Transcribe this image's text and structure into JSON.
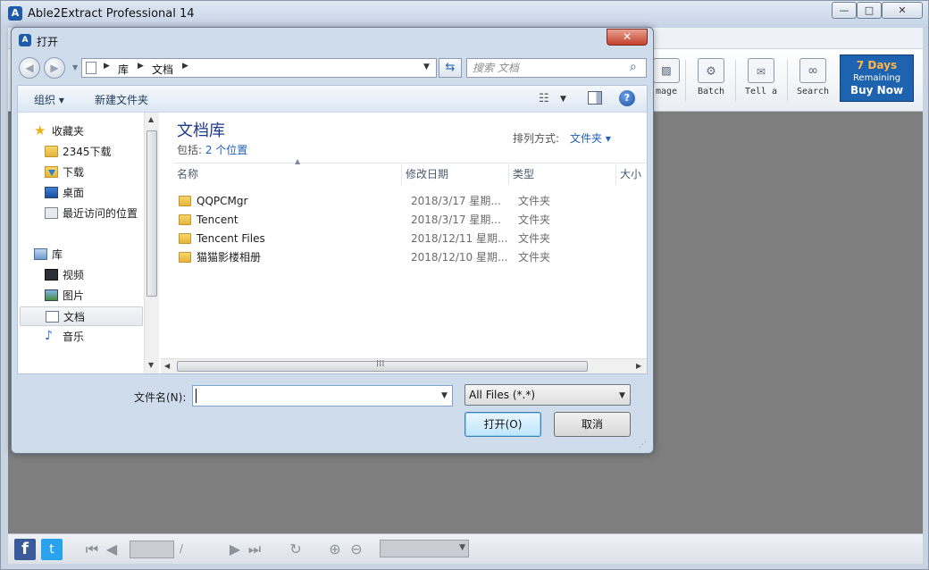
{
  "app": {
    "title": "Able2Extract Professional 14",
    "icon": "app-logo-icon",
    "window_buttons": {
      "minimize": "—",
      "maximize": "□",
      "close": "✕"
    },
    "toolbar": {
      "tools": [
        {
          "label": "mage",
          "icon": "image-icon"
        },
        {
          "label": "Batch",
          "icon": "batch-gear-icon"
        },
        {
          "label": "Tell a",
          "icon": "envelope-icon"
        },
        {
          "label": "Search",
          "icon": "binoculars-icon"
        }
      ],
      "promo": {
        "days": "7 Days",
        "remaining": "Remaining",
        "buy": "Buy Now",
        "bg_color": "#1e63b0",
        "days_color": "#ffb64a"
      }
    },
    "statusbar": {
      "facebook": "f",
      "twitter": "t",
      "page_separator": "/"
    }
  },
  "dialog": {
    "title": "打开",
    "close_glyph": "✕",
    "address": {
      "crumbs": [
        "库",
        "文档"
      ],
      "search_placeholder": "搜索 文档"
    },
    "commands": {
      "organize": "组织 ▾",
      "new_folder": "新建文件夹"
    },
    "nav": {
      "favorites": {
        "label": "收藏夹",
        "items": [
          {
            "label": "2345下载",
            "icon": "folder-icon"
          },
          {
            "label": "下载",
            "icon": "downloads-folder-icon"
          },
          {
            "label": "桌面",
            "icon": "desktop-icon"
          },
          {
            "label": "最近访问的位置",
            "icon": "recent-places-icon"
          }
        ]
      },
      "libraries": {
        "label": "库",
        "items": [
          {
            "label": "视频",
            "icon": "video-library-icon"
          },
          {
            "label": "图片",
            "icon": "pictures-library-icon"
          },
          {
            "label": "文档",
            "icon": "documents-library-icon",
            "selected": true
          },
          {
            "label": "音乐",
            "icon": "music-library-icon"
          }
        ]
      }
    },
    "library": {
      "title": "文档库",
      "include_prefix": "包括: ",
      "include_locations": "2 个位置",
      "arrange_label": "排列方式:",
      "arrange_value": "文件夹 ▾"
    },
    "columns": [
      "名称",
      "修改日期",
      "类型",
      "大小"
    ],
    "files": [
      {
        "name": "QQPCMgr",
        "date": "2018/3/17 星期...",
        "type": "文件夹"
      },
      {
        "name": "Tencent",
        "date": "2018/3/17 星期...",
        "type": "文件夹"
      },
      {
        "name": "Tencent Files",
        "date": "2018/12/11 星期...",
        "type": "文件夹"
      },
      {
        "name": "猫猫影楼相册",
        "date": "2018/12/10 星期...",
        "type": "文件夹"
      }
    ],
    "filename_label": "文件名(N):",
    "filename_value": "",
    "filetype": "All Files (*.*)",
    "open_button": "打开(O)",
    "cancel_button": "取消"
  }
}
